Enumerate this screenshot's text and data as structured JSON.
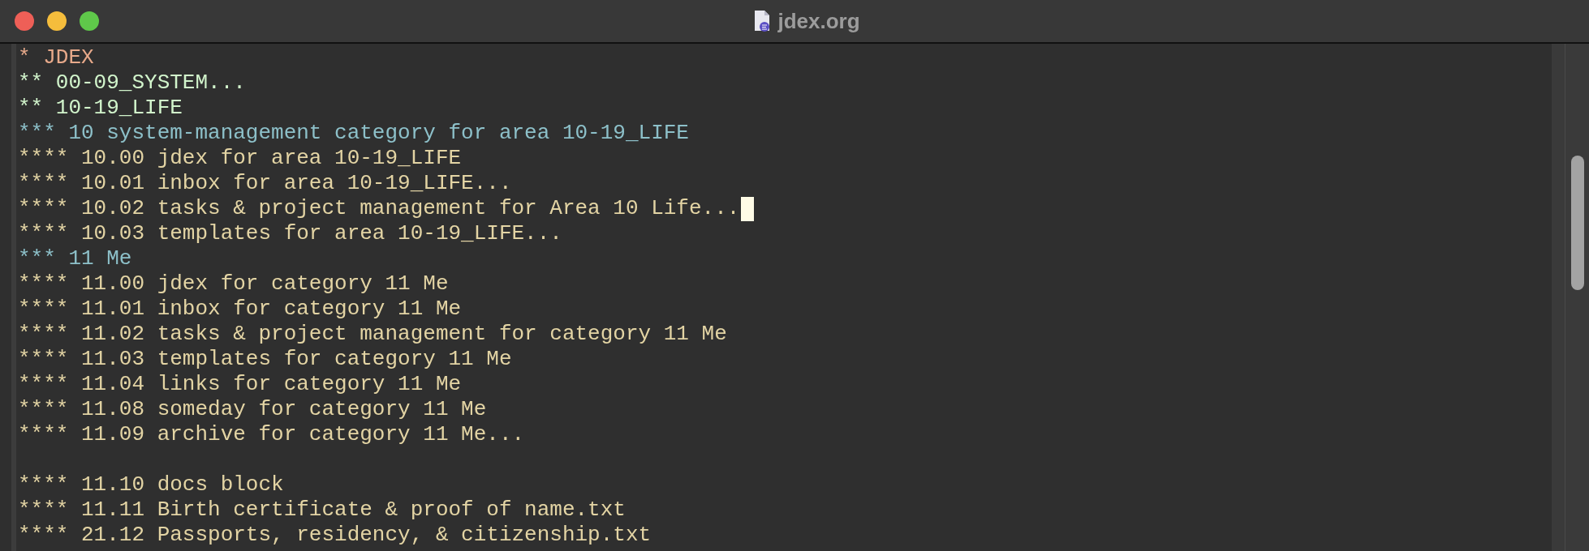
{
  "window": {
    "title": "jdex.org"
  },
  "outline": [
    {
      "text": "* JDEX",
      "children": [
        {
          "text": "** 00-09_SYSTEM..."
        },
        {
          "text": "** 10-19_LIFE",
          "children": [
            {
              "text": "*** 10 system-management category for area 10-19_LIFE",
              "children": [
                {
                  "text": "**** 10.00 jdex for area 10-19_LIFE"
                },
                {
                  "text": "**** 10.01 inbox for area 10-19_LIFE..."
                },
                {
                  "text": "**** 10.02 tasks & project management for Area 10 Life...",
                  "cursor": true
                },
                {
                  "text": "**** 10.03 templates for area 10-19_LIFE..."
                }
              ]
            },
            {
              "text": "*** 11 Me",
              "children": [
                {
                  "text": "**** 11.00 jdex for category 11 Me"
                },
                {
                  "text": "**** 11.01 inbox for category 11 Me"
                },
                {
                  "text": "**** 11.02 tasks & project management for category 11 Me"
                },
                {
                  "text": "**** 11.03 templates for category 11 Me"
                },
                {
                  "text": "**** 11.04 links for category 11 Me"
                },
                {
                  "text": "**** 11.08 someday for category 11 Me"
                },
                {
                  "text": "**** 11.09 archive for category 11 Me..."
                },
                {
                  "text": "**** 11.10 docs block",
                  "gap_before": true
                },
                {
                  "text": "**** 11.11 Birth certificate & proof of name.txt"
                },
                {
                  "text": "**** 21.12 Passports, residency, & citizenship.txt"
                }
              ]
            }
          ]
        }
      ]
    }
  ]
}
